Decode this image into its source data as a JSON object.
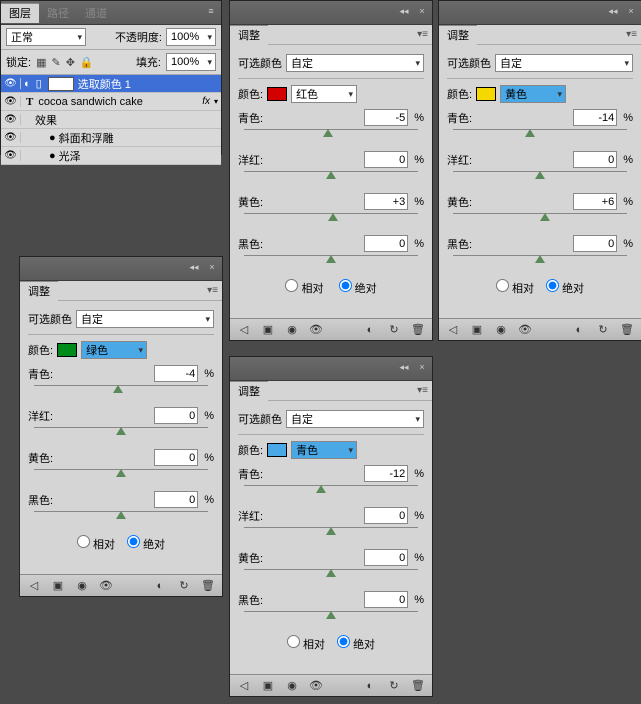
{
  "layers_panel": {
    "tabs": [
      "图层",
      "路径",
      "通道"
    ],
    "blend_mode": "正常",
    "opacity_label": "不透明度:",
    "opacity_value": "100%",
    "lock_label": "锁定:",
    "fill_label": "填充:",
    "fill_value": "100%",
    "items": [
      {
        "name": "选取颜色 1",
        "selected": true,
        "icons": [
          "eye",
          "mask"
        ],
        "thumb": "#ffffff"
      },
      {
        "name": "cocoa sandwich cake",
        "selected": false,
        "type": "T",
        "fx": "fx"
      },
      {
        "name": "效果",
        "indent": 1
      },
      {
        "name": "斜面和浮雕",
        "indent": 2,
        "eye": true
      },
      {
        "name": "光泽",
        "indent": 2,
        "eye": true
      }
    ]
  },
  "adjust": {
    "tab": "调整",
    "dropdown_label": "可选颜色",
    "dropdown_value": "自定",
    "color_label": "颜色:",
    "sliders": [
      {
        "label": "青色:",
        "pct": "%"
      },
      {
        "label": "洋红:",
        "pct": "%"
      },
      {
        "label": "黄色:",
        "pct": "%"
      },
      {
        "label": "黑色:",
        "pct": "%"
      }
    ],
    "radio_rel": "相对",
    "radio_abs": "绝对"
  },
  "p_red": {
    "swatch": "#d40000",
    "color_name": "红色",
    "vals": [
      "-5",
      "0",
      "+3",
      "0"
    ],
    "mode": "abs"
  },
  "p_yel": {
    "swatch": "#f5d800",
    "color_name": "黄色",
    "vals": [
      "-14",
      "0",
      "+6",
      "0"
    ],
    "mode": "abs"
  },
  "p_grn": {
    "swatch": "#008a1a",
    "color_name": "绿色",
    "vals": [
      "-4",
      "0",
      "0",
      "0"
    ],
    "mode": "abs"
  },
  "p_cyn": {
    "swatch": "#4aa8e6",
    "color_name": "青色",
    "vals": [
      "-12",
      "0",
      "0",
      "0"
    ],
    "mode": "abs"
  },
  "chart_data": null
}
